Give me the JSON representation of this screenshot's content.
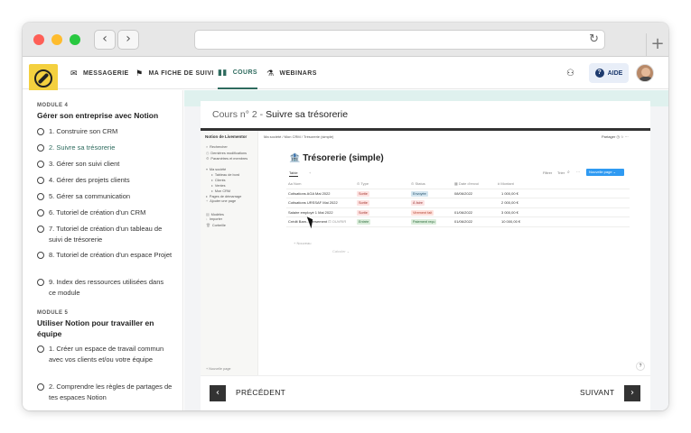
{
  "nav": {
    "items": [
      {
        "label": "MESSAGERIE",
        "icon": "mail-icon"
      },
      {
        "label": "MA FICHE DE SUIVI",
        "icon": "flag-icon"
      },
      {
        "label": "COURS",
        "icon": "book-icon"
      },
      {
        "label": "WEBINARS",
        "icon": "microscope-icon"
      }
    ],
    "active": "COURS",
    "help_label": "AIDE"
  },
  "sidebar": {
    "module4": {
      "label": "MODULE 4",
      "title": "Gérer son entreprise avec Notion",
      "lessons": [
        "1. Construire son CRM",
        "2. Suivre sa trésorerie",
        "3. Gérer son suivi client",
        "4. Gérer des projets clients",
        "5. Gérer sa communication",
        "6. Tutoriel de création d'un CRM",
        "7. Tutoriel de création d'un tableau de suivi de trésorerie",
        "8. Tutoriel de création d'un espace Projet",
        "9. Index des ressources utilisées dans ce module"
      ]
    },
    "module5": {
      "label": "MODULE 5",
      "title": "Utiliser Notion pour travailler en équipe",
      "lessons": [
        "1. Créer un espace de travail commun avec vos clients et/ou votre équipe",
        "2. Comprendre les règles de partages de tes espaces Notion"
      ]
    }
  },
  "course": {
    "number": "Cours n° 2 -",
    "title": "Suivre sa trésorerie",
    "prev_label": "PRÉCÉDENT",
    "next_label": "SUIVANT"
  },
  "notion": {
    "workspace": "Notion de Livementor",
    "sidebar_items": [
      "Rechercher",
      "Dernières modifications",
      "Paramètres et membres",
      "Ma société",
      "Tableau de bord",
      "Clients",
      "Ventes",
      "Mon CRM",
      "Pages de démarrage",
      "Ajouter une page",
      "Modèles",
      "Importer",
      "Corbeille"
    ],
    "breadcrumb": "Ma société / Mon CRM / Trésorerie (simple)",
    "share_label": "Partager",
    "page_title": "🏦 Trésorerie (simple)",
    "view_tab": "Table",
    "toolbar": {
      "filter": "Filtrer",
      "sort": "Trier",
      "more": "···",
      "new_page": "Nouvelle page ⌄"
    },
    "columns": [
      "Aa Nom",
      "⊙ Type",
      "⊙ Status",
      "▦ Date d'envoi",
      "# Montant"
    ],
    "rows": [
      {
        "name": "Cotisations AGA Mai 2022",
        "type": "Sortie",
        "status": "Envoyée",
        "date": "08/06/2022",
        "amount": "1 000,00 €"
      },
      {
        "name": "Cotisations URSSAF Mai 2022",
        "type": "Sortie",
        "status": "À faire",
        "date": "",
        "amount": "2 000,00 €"
      },
      {
        "name": "Salaire employé 1 Mai 2022",
        "type": "Sortie",
        "status": "Virement fait",
        "date": "01/06/2022",
        "amount": "3 000,00 €"
      },
      {
        "name": "Crédit Bam... versement",
        "type": "Entrée",
        "status": "Paiement reçu",
        "date": "01/06/2022",
        "amount": "10 000,00 €"
      }
    ],
    "open_label": "⊡ OUVRIR",
    "new_row": "+ Nouveau",
    "calculate": "Calculer ⌄",
    "new_page_sidebar": "+ Nouvelle page",
    "help": "?"
  }
}
